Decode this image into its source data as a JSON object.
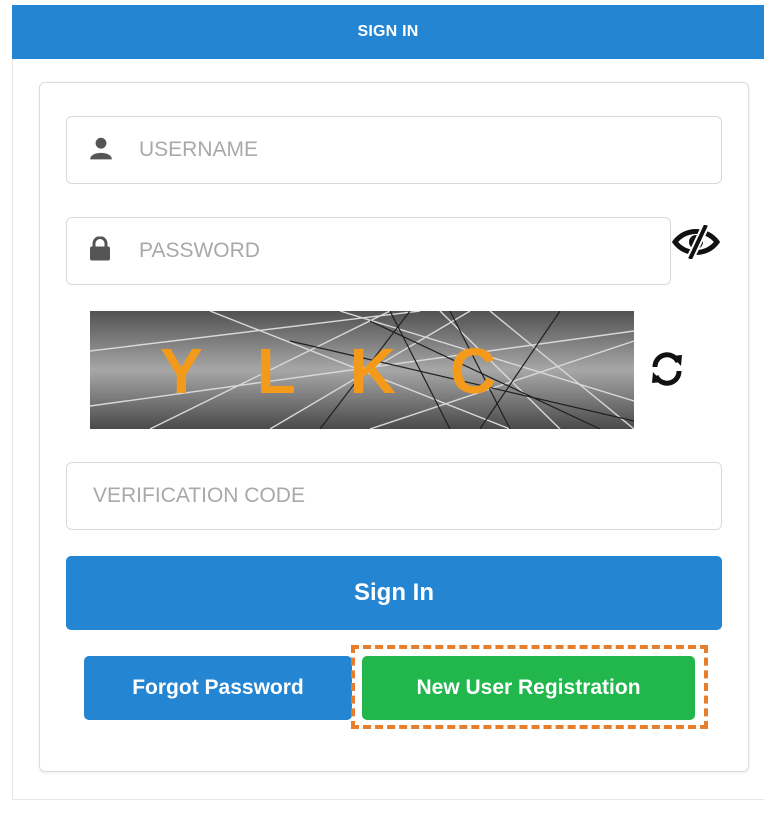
{
  "header": {
    "title": "SIGN IN"
  },
  "form": {
    "username": {
      "placeholder": "USERNAME",
      "value": "",
      "icon": "user-icon"
    },
    "password": {
      "placeholder": "PASSWORD",
      "value": "",
      "icon": "lock-icon",
      "toggle_icon": "eye-slash-icon"
    },
    "captcha": {
      "text": "YLKC",
      "refresh_icon": "refresh-icon"
    },
    "verification": {
      "placeholder": "VERIFICATION CODE",
      "value": ""
    }
  },
  "buttons": {
    "sign_in": "Sign In",
    "forgot_password": "Forgot Password",
    "new_user_registration": "New User Registration"
  },
  "colors": {
    "primary": "#2485d3",
    "success": "#22b74d",
    "highlight": "#e87d2a",
    "captcha_text": "#f39a1a"
  }
}
